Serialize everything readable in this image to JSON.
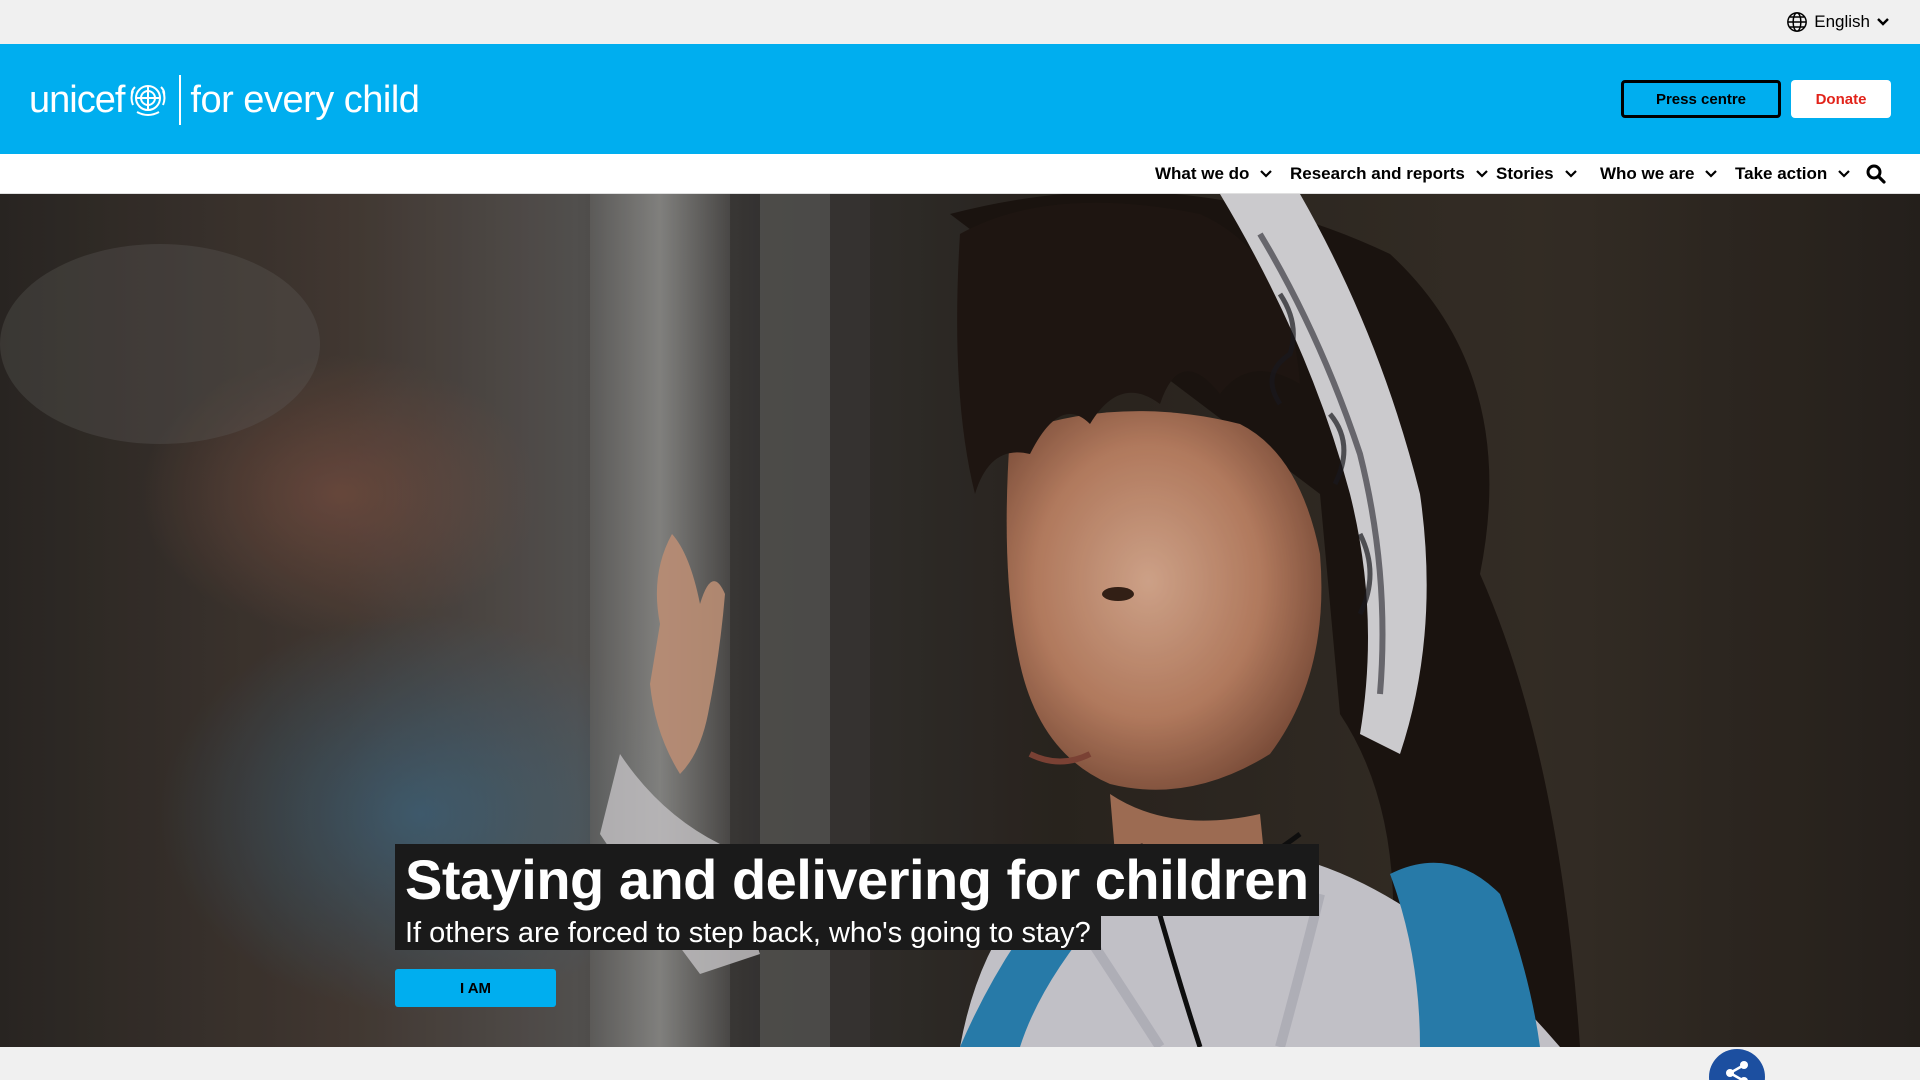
{
  "utility": {
    "language": "English"
  },
  "brand": {
    "logo_word": "unicef",
    "tagline": "for every child"
  },
  "header_buttons": {
    "press": "Press centre",
    "donate": "Donate"
  },
  "nav": [
    {
      "label": "What we do"
    },
    {
      "label": "Research and reports"
    },
    {
      "label": "Stories"
    },
    {
      "label": "Who we are"
    },
    {
      "label": "Take action"
    }
  ],
  "hero": {
    "title": "Staying and delivering for children",
    "subtitle": "If others are forced to step back, who's going to stay?",
    "cta": "I AM"
  },
  "colors": {
    "brand_blue": "#00aeef",
    "donate_red": "#e2231a",
    "share_blue": "#1c4fa0",
    "caption_bg": "#1a1a1a"
  },
  "icons": [
    "globe-icon",
    "chevron-down-icon",
    "search-icon",
    "share-icon",
    "unicef-emblem-icon"
  ]
}
